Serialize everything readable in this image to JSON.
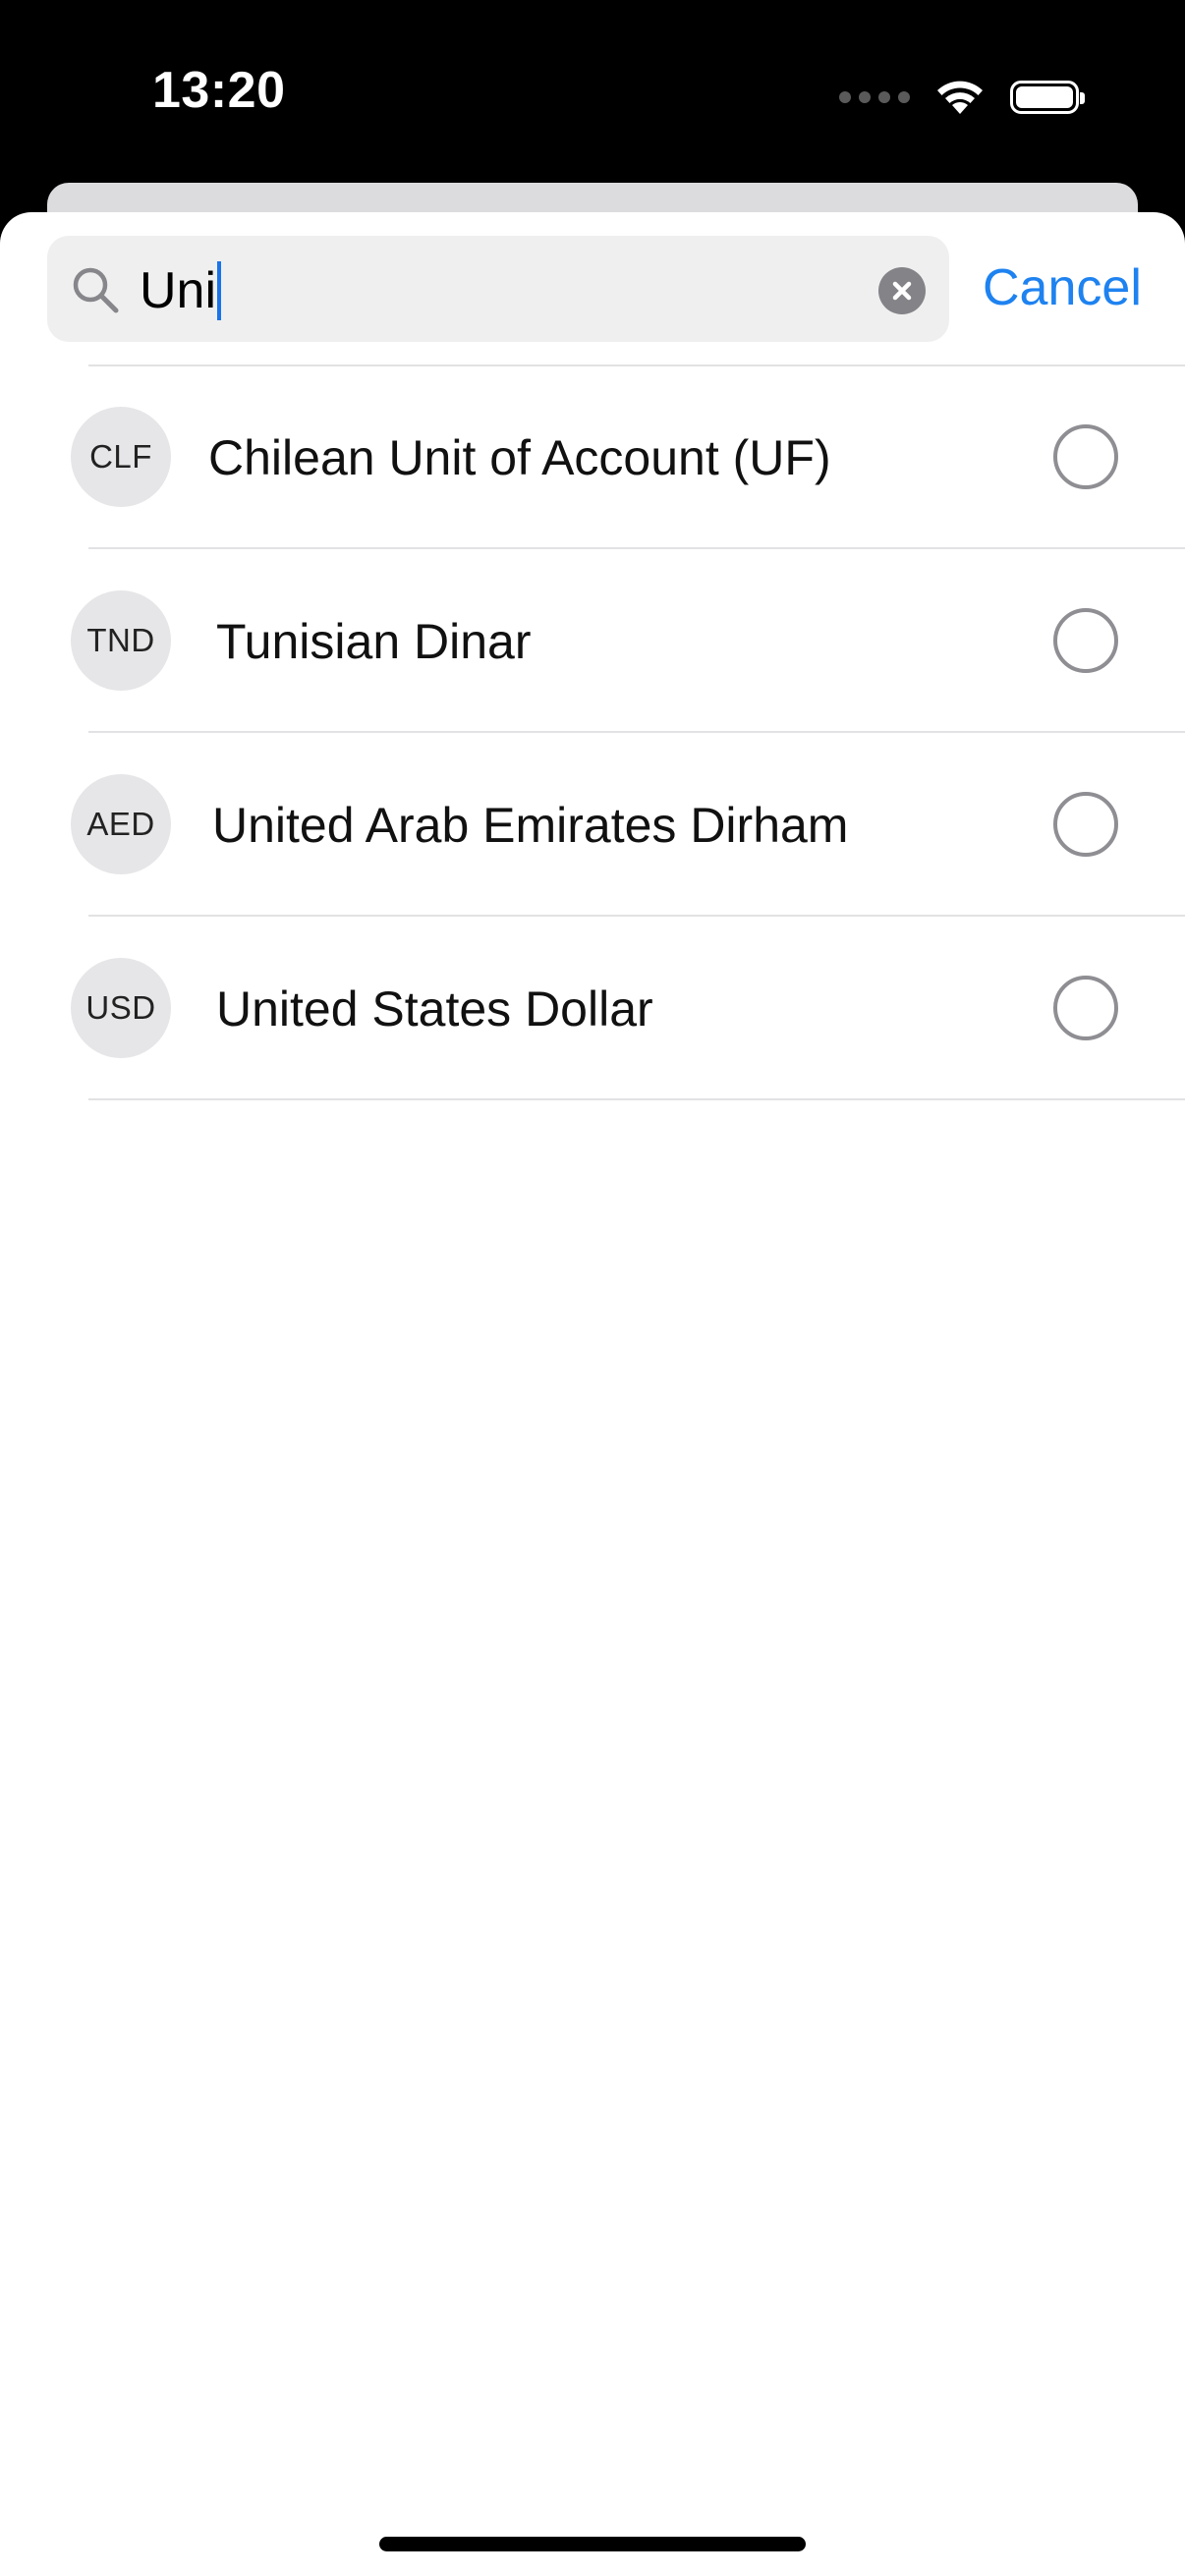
{
  "status_bar": {
    "time": "13:20",
    "icons": [
      "cellular-dots-icon",
      "wifi-icon",
      "battery-icon"
    ]
  },
  "search": {
    "value": "Uni",
    "icon": "search-icon",
    "clear_icon": "clear-icon",
    "cancel_label": "Cancel"
  },
  "currencies": [
    {
      "code": "CLF",
      "name": "Chilean Unit of Account (UF)",
      "selected": false
    },
    {
      "code": "TND",
      "name": "Tunisian Dinar",
      "selected": false
    },
    {
      "code": "AED",
      "name": "United Arab Emirates Dirham",
      "selected": false
    },
    {
      "code": "USD",
      "name": "United States Dollar",
      "selected": false
    }
  ],
  "colors": {
    "accent": "#1e82f0",
    "badge_bg": "#e6e6e8",
    "radio_border": "#8e8e93"
  }
}
